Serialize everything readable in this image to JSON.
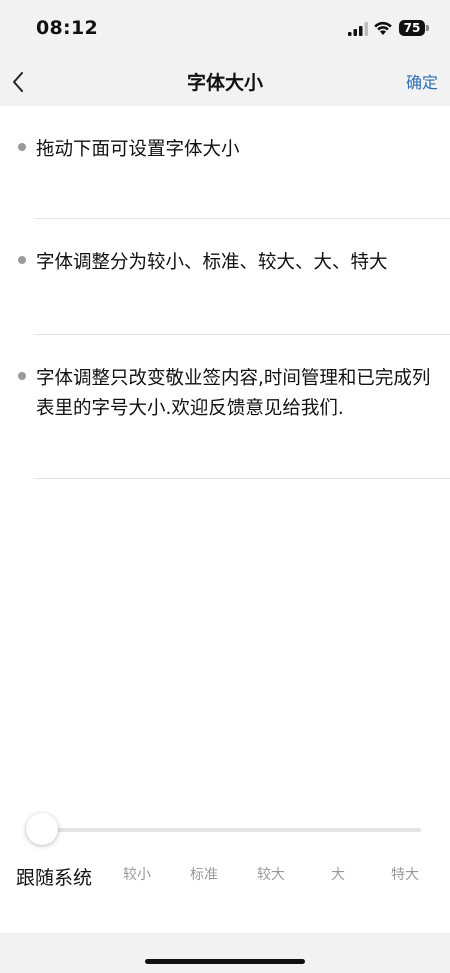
{
  "status_bar": {
    "time": "08:12",
    "battery": "75"
  },
  "nav": {
    "title": "字体大小",
    "confirm_label": "确定"
  },
  "tips": [
    "拖动下面可设置字体大小",
    "字体调整分为较小、标准、较大、大、特大",
    "字体调整只改变敬业签内容,时间管理和已完成列表里的字号大小.欢迎反馈意见给我们."
  ],
  "slider": {
    "follow_system_label": "跟随系统",
    "options": [
      "较小",
      "标准",
      "较大",
      "大",
      "特大"
    ],
    "selected": "跟随系统"
  },
  "colors": {
    "accent": "#2f6fb3",
    "bar_background": "#f2f2f2",
    "muted_text": "#9a9a9a"
  }
}
